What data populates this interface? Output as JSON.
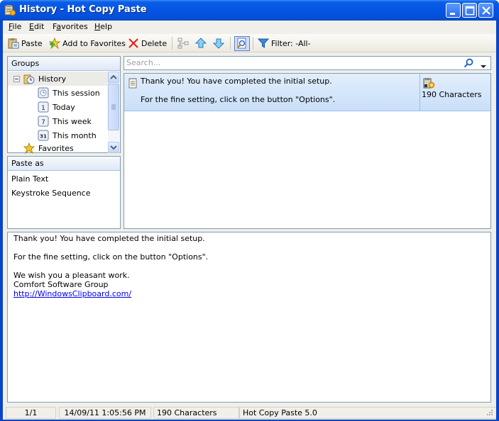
{
  "window": {
    "title": "History - Hot Copy Paste",
    "controls": [
      "minimize",
      "maximize",
      "close"
    ]
  },
  "menu": {
    "items": [
      {
        "label": "File",
        "mnemonic": "F"
      },
      {
        "label": "Edit",
        "mnemonic": "E"
      },
      {
        "label": "Favorites",
        "mnemonic": "a"
      },
      {
        "label": "Help",
        "mnemonic": "H"
      }
    ]
  },
  "toolbar": {
    "paste_label": "Paste",
    "add_favorites_label": "Add to Favorites",
    "delete_label": "Delete",
    "filter_label": "Filter: -All-"
  },
  "groups": {
    "header": "Groups",
    "items": [
      {
        "label": "History",
        "icon": "history-icon",
        "expanded": true,
        "selected": true
      },
      {
        "label": "This session",
        "icon": "session-clock-icon"
      },
      {
        "label": "Today",
        "icon": "calendar-1-icon",
        "badge": "1"
      },
      {
        "label": "This week",
        "icon": "calendar-7-icon",
        "badge": "7"
      },
      {
        "label": "This month",
        "icon": "calendar-31-icon",
        "badge": "31"
      },
      {
        "label": "Favorites",
        "icon": "star-icon"
      }
    ]
  },
  "paste_as": {
    "header": "Paste as",
    "items": [
      "Plain Text",
      "Keystroke Sequence"
    ]
  },
  "search": {
    "placeholder": "Search..."
  },
  "clips": [
    {
      "line1": "Thank you! You have completed the initial setup.",
      "line2": "For the fine setting, click on the button \"Options\".",
      "size": "190 Characters"
    }
  ],
  "preview": {
    "lines": [
      "Thank you! You have completed the initial setup.",
      "",
      "For the fine setting, click on the button \"Options\".",
      "",
      "We wish you a pleasant work.",
      "Comfort Software Group"
    ],
    "link": "http://WindowsClipboard.com/"
  },
  "status": {
    "position": "1/1",
    "timestamp": "14/09/11 1:05:56 PM",
    "size": "190 Characters",
    "version": "Hot Copy Paste 5.0"
  }
}
